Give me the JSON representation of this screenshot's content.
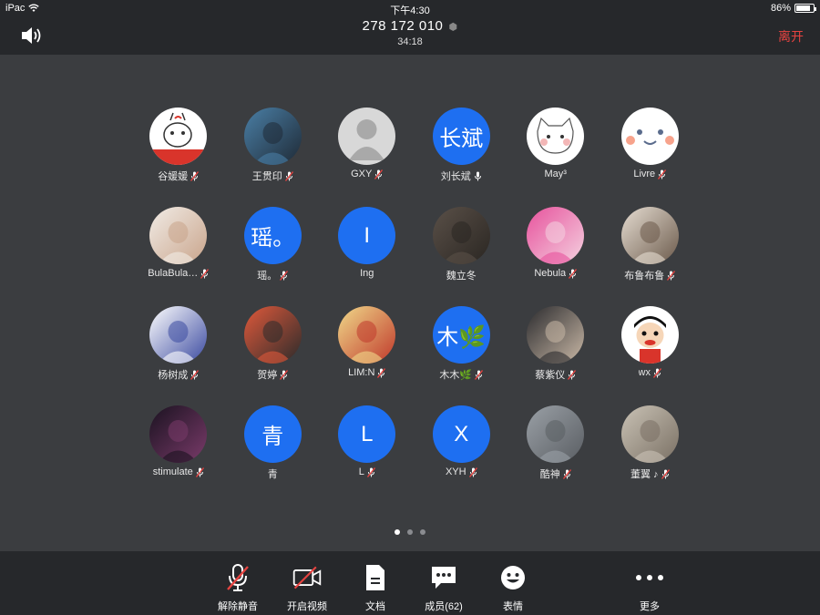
{
  "status_bar": {
    "device": "iPac",
    "time": "下午4:30",
    "battery": "86%",
    "battery_level": 0.86
  },
  "header": {
    "meeting_id": "278 172 010",
    "duration": "34:18",
    "leave_label": "离开"
  },
  "members": [
    {
      "name": "谷媛媛",
      "initial": "",
      "photo": "cartoon-bunny",
      "colors": [
        "#ffffff",
        "#d9342b"
      ],
      "mic": "muted"
    },
    {
      "name": "王贯印",
      "initial": "",
      "photo": "couple-photo",
      "colors": [
        "#4a7fa6",
        "#1f2a36"
      ],
      "mic": "muted"
    },
    {
      "name": "GXY",
      "initial": "",
      "photo": "default-silhouette",
      "colors": [
        "#d8d8d8",
        "#a9a9a9"
      ],
      "mic": "muted"
    },
    {
      "name": "刘长斌",
      "initial": "长斌",
      "photo": "",
      "colors": [
        "#1e6ff1"
      ],
      "mic": "on"
    },
    {
      "name": "May³",
      "initial": "",
      "photo": "cartoon-cat",
      "colors": [
        "#ffffff",
        "#f3b7b7"
      ],
      "mic": "none"
    },
    {
      "name": "Livre",
      "initial": "",
      "photo": "smiley-face",
      "colors": [
        "#ffffff",
        "#f7a38c"
      ],
      "mic": "muted"
    },
    {
      "name": "BulaBula…",
      "initial": "",
      "photo": "anime-girl",
      "colors": [
        "#f1ece6",
        "#c9a48b"
      ],
      "mic": "muted"
    },
    {
      "name": "瑶。",
      "initial": "瑶。",
      "photo": "",
      "colors": [
        "#1e6ff1"
      ],
      "mic": "muted"
    },
    {
      "name": "Ing",
      "initial": "I",
      "photo": "",
      "colors": [
        "#1e6ff1"
      ],
      "mic": "none"
    },
    {
      "name": "魏立冬",
      "initial": "",
      "photo": "dark-portrait",
      "colors": [
        "#5a5048",
        "#2a2622"
      ],
      "mic": "none"
    },
    {
      "name": "Nebula",
      "initial": "",
      "photo": "pink-cartoon",
      "colors": [
        "#e7519c",
        "#f4d2e0"
      ],
      "mic": "muted"
    },
    {
      "name": "布鲁布鲁",
      "initial": "",
      "photo": "girl-photo",
      "colors": [
        "#e6ddd2",
        "#6b5a4b"
      ],
      "mic": "muted"
    },
    {
      "name": "杨树成",
      "initial": "",
      "photo": "school-badge",
      "colors": [
        "#ffffff",
        "#3b4aa0"
      ],
      "mic": "muted"
    },
    {
      "name": "贺婷",
      "initial": "",
      "photo": "illustration-girl",
      "colors": [
        "#e0593b",
        "#2b2b2b"
      ],
      "mic": "muted"
    },
    {
      "name": "LIM:N",
      "initial": "",
      "photo": "anime-blonde",
      "colors": [
        "#f0d98a",
        "#c0392b"
      ],
      "mic": "muted"
    },
    {
      "name": "木木🌿",
      "initial": "木🌿",
      "photo": "",
      "colors": [
        "#1e6ff1"
      ],
      "mic": "muted"
    },
    {
      "name": "蔡紫仪",
      "initial": "",
      "photo": "sketch-portrait",
      "colors": [
        "#2b2b2e",
        "#c9b8a6"
      ],
      "mic": "muted"
    },
    {
      "name": "wx",
      "initial": "",
      "photo": "cartoon-boy",
      "colors": [
        "#ffffff",
        "#d9342b"
      ],
      "mic": "muted"
    },
    {
      "name": "stimulate",
      "initial": "",
      "photo": "night-photo",
      "colors": [
        "#1a1220",
        "#7a3b6a"
      ],
      "mic": "muted"
    },
    {
      "name": "青",
      "initial": "青",
      "photo": "",
      "colors": [
        "#1e6ff1"
      ],
      "mic": "none"
    },
    {
      "name": "L",
      "initial": "L",
      "photo": "",
      "colors": [
        "#1e6ff1"
      ],
      "mic": "muted"
    },
    {
      "name": "XYH",
      "initial": "X",
      "photo": "",
      "colors": [
        "#1e6ff1"
      ],
      "mic": "muted"
    },
    {
      "name": "酷神",
      "initial": "",
      "photo": "cat-photo",
      "colors": [
        "#9aa0a6",
        "#5a5e63"
      ],
      "mic": "muted"
    },
    {
      "name": "董翼 ♪",
      "initial": "",
      "photo": "group-photo",
      "colors": [
        "#c9c2b5",
        "#7a7064"
      ],
      "mic": "muted"
    }
  ],
  "pager": {
    "pages": 3,
    "current": 1
  },
  "toolbar": {
    "unmute_label": "解除静音",
    "video_label": "开启视频",
    "docs_label": "文档",
    "members_label": "成员(62)",
    "emoji_label": "表情",
    "more_label": "更多"
  },
  "colors": {
    "background": "#3b3d40",
    "bar": "#26282b",
    "accent_blue": "#1e6ff1",
    "leave_red": "#e64340",
    "mute_red": "#e64340"
  }
}
